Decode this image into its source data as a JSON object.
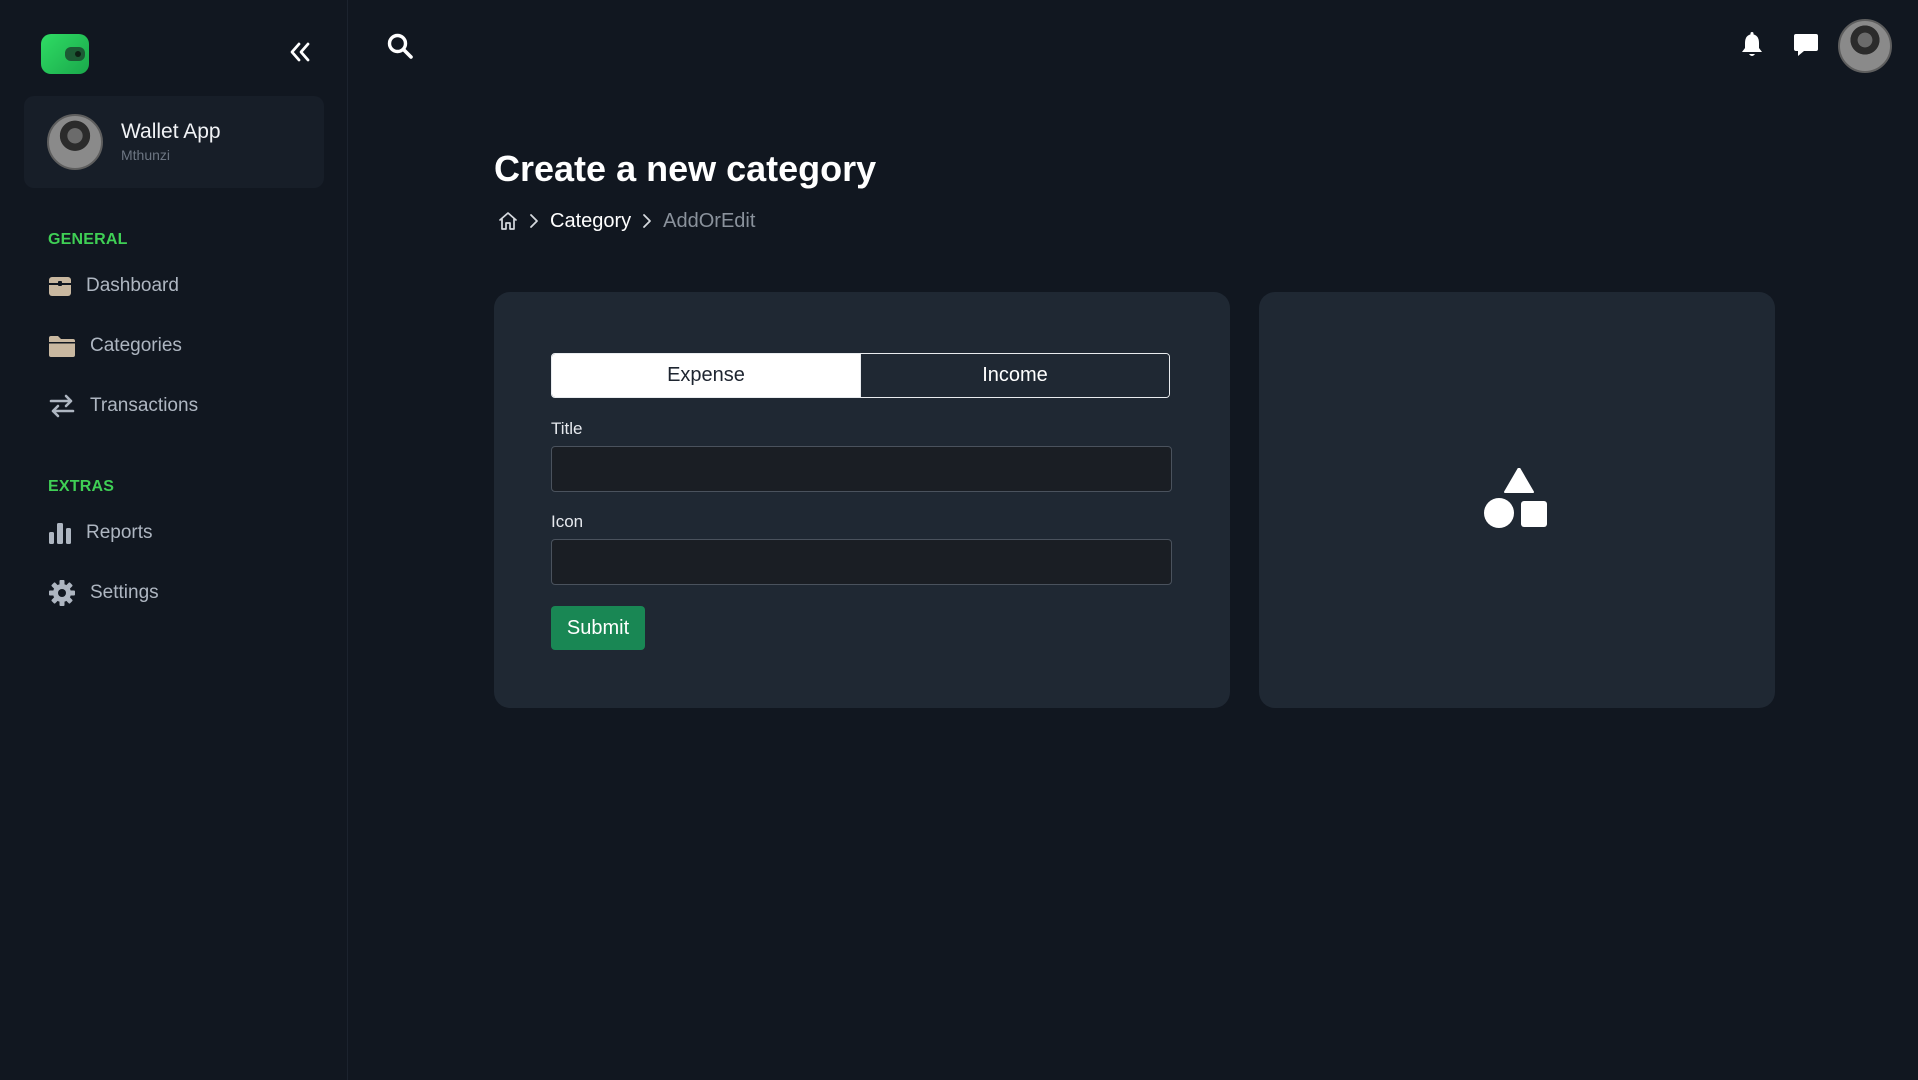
{
  "sidebar": {
    "logo_icon": "wallet-icon",
    "collapse_icon": "double-chevron-left-icon",
    "profile": {
      "name": "Wallet App",
      "subtitle": "Mthunzi"
    },
    "sections": [
      {
        "label": "GENERAL",
        "items": [
          {
            "label": "Dashboard",
            "icon": "dashboard-icon"
          },
          {
            "label": "Categories",
            "icon": "folder-icon"
          },
          {
            "label": "Transactions",
            "icon": "transfer-icon"
          }
        ]
      },
      {
        "label": "EXTRAS",
        "items": [
          {
            "label": "Reports",
            "icon": "bar-chart-icon"
          },
          {
            "label": "Settings",
            "icon": "gear-icon"
          }
        ]
      }
    ]
  },
  "topbar": {
    "search_icon": "search-icon",
    "notifications_icon": "bell-icon",
    "messages_icon": "chat-icon"
  },
  "page": {
    "title": "Create a new category",
    "breadcrumb": [
      "Category",
      "AddOrEdit"
    ]
  },
  "form": {
    "type_options": [
      "Expense",
      "Income"
    ],
    "selected_type": "Expense",
    "title_label": "Title",
    "title_value": "",
    "icon_label": "Icon",
    "icon_value": "",
    "submit_label": "Submit"
  },
  "preview": {
    "icon": "shapes-icon"
  },
  "colors": {
    "background": "#111720",
    "card": "#1f2833",
    "accent_green": "#3fcf55",
    "submit_green": "#198754"
  }
}
